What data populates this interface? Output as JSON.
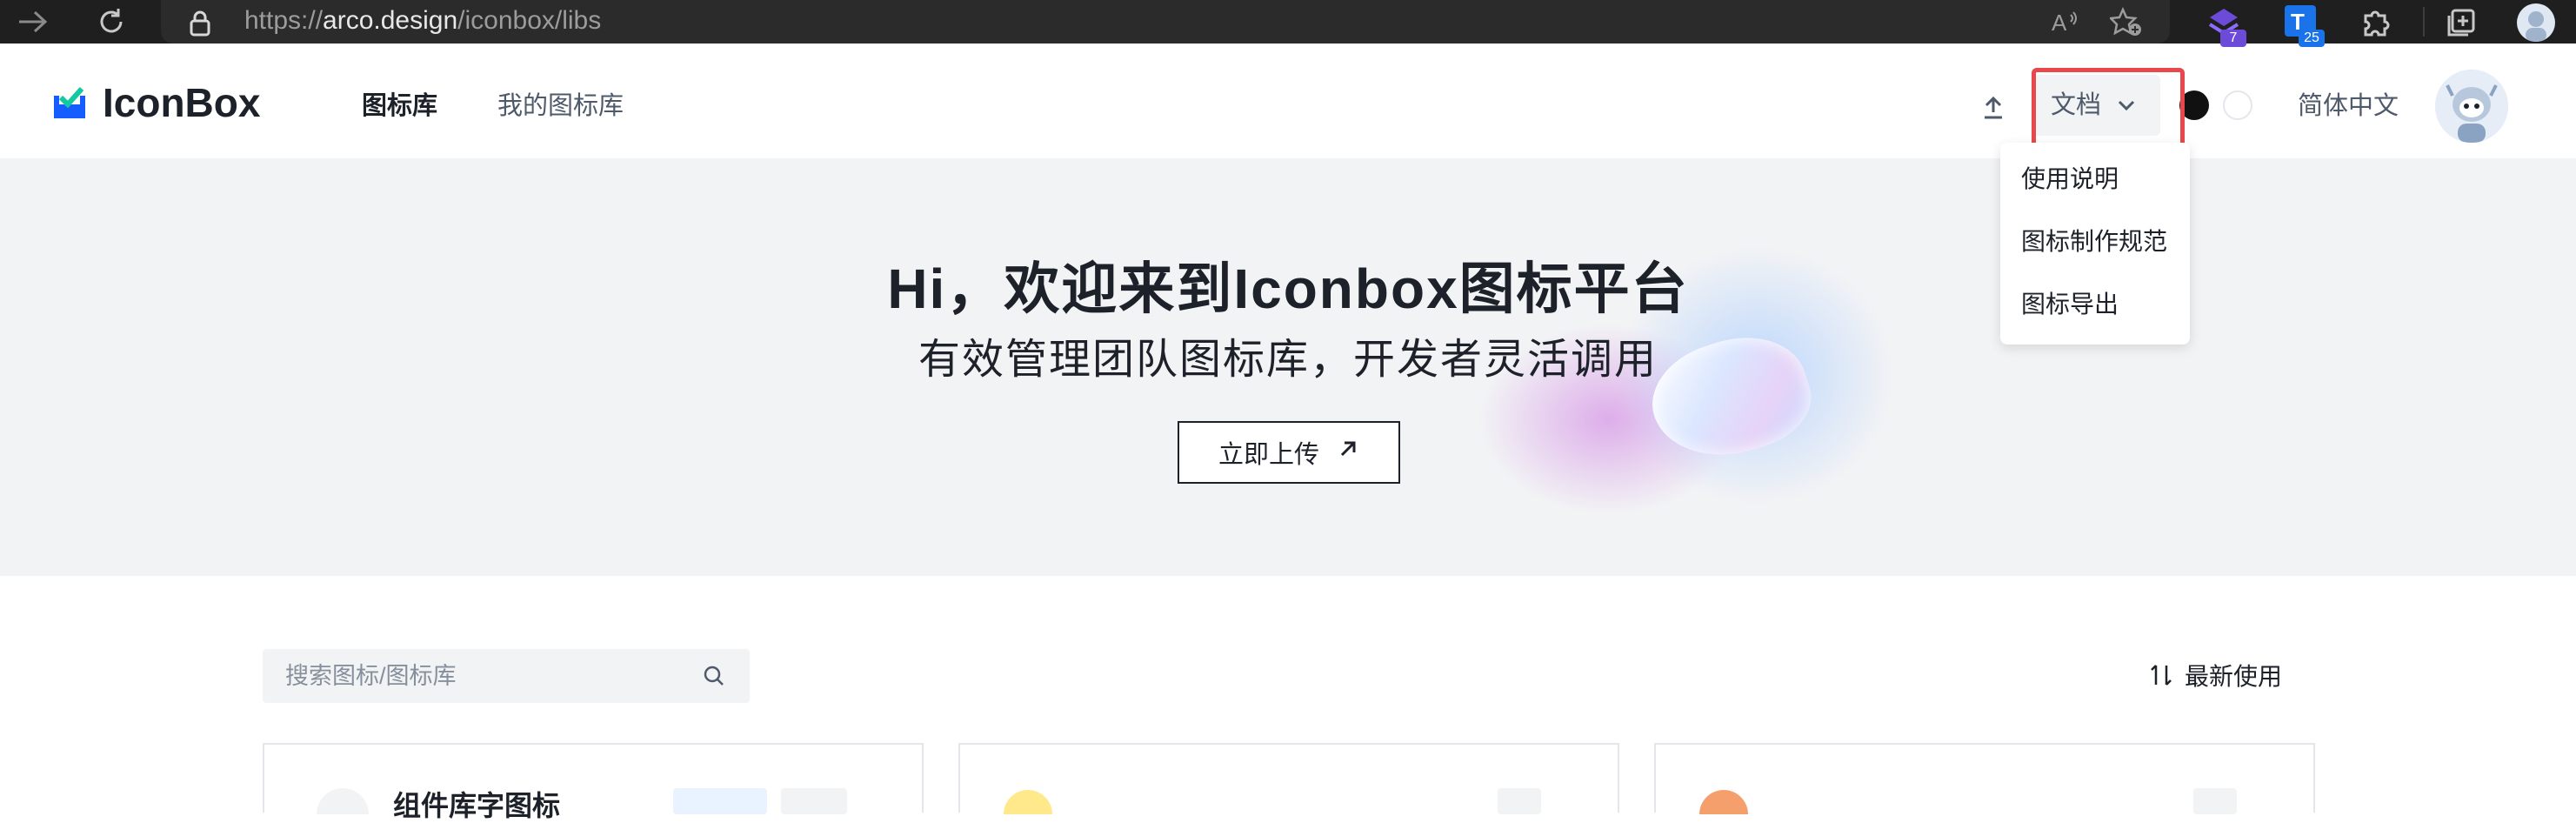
{
  "browser": {
    "url_prefix": "https://",
    "url_host": "arco.design",
    "url_path": "/iconbox/libs",
    "extensions": [
      {
        "name": "extension-purple-icon",
        "badge": "7",
        "color": "#6b4bd8"
      },
      {
        "name": "extension-translate-icon",
        "badge": "25",
        "color": "#1a73e8"
      }
    ]
  },
  "header": {
    "brand": "IconBox",
    "nav": [
      {
        "label": "图标库",
        "active": true
      },
      {
        "label": "我的图标库",
        "active": false
      }
    ],
    "docs_label": "文档",
    "language_label": "简体中文"
  },
  "dropdown": {
    "items": [
      "使用说明",
      "图标制作规范",
      "图标导出"
    ]
  },
  "hero": {
    "title": "Hi，欢迎来到Iconbox图标平台",
    "subtitle": "有效管理团队图标库，开发者灵活调用",
    "upload_label": "立即上传"
  },
  "toolbar": {
    "search_placeholder": "搜索图标/图标库",
    "sort_label": "最新使用"
  },
  "cards": [
    {
      "title": "组件库字图标"
    },
    {
      "title": ""
    },
    {
      "title": ""
    }
  ],
  "colors": {
    "accent_blue": "#165dff",
    "highlight_red": "#e8484b",
    "hero_bg": "#f2f3f5"
  }
}
